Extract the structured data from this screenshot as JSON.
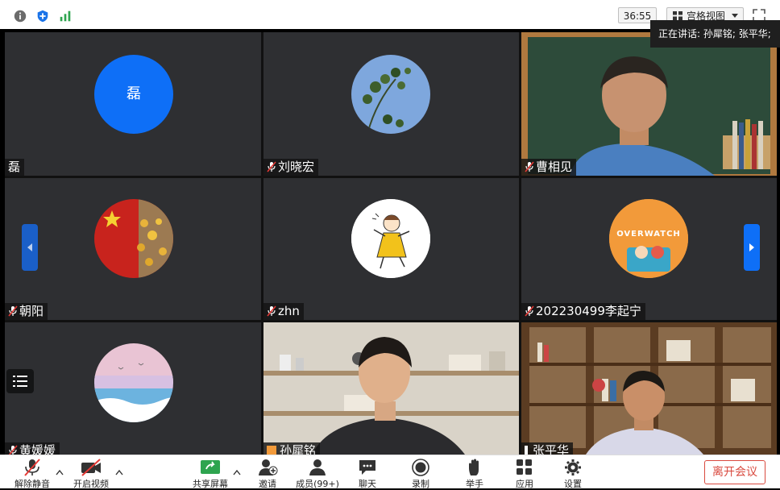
{
  "top_bar": {
    "info_icon": "info-icon",
    "shield_icon": "shield-icon",
    "signal_icon": "signal-icon",
    "timer": "36:55",
    "view_label": "宫格视图",
    "fullscreen_icon": "fullscreen-icon"
  },
  "speaking_banner": "正在讲话: 孙犀铭; 张平华;",
  "participants": [
    {
      "name": "磊",
      "avatar_text": "磊",
      "avatar_color": "#0e6ff7",
      "muted": false
    },
    {
      "name": "刘晓宏",
      "muted": true
    },
    {
      "name": "曹相见",
      "muted": true
    },
    {
      "name": "朝阳",
      "muted": true
    },
    {
      "name": "zhn",
      "muted": true
    },
    {
      "name": "202230499李起宁",
      "avatar_text": "OVERWATCH",
      "muted": true
    },
    {
      "name": "黄媛媛",
      "muted": true
    },
    {
      "name": "孙犀铭",
      "muted": false,
      "speaking": true
    },
    {
      "name": "张平华",
      "muted": false,
      "speaking": true
    }
  ],
  "toolbar": {
    "unmute": "解除静音",
    "start_video": "开启视频",
    "share_screen": "共享屏幕",
    "invite": "邀请",
    "members": "成员(99+)",
    "chat": "聊天",
    "record": "录制",
    "raise_hand": "举手",
    "apps": "应用",
    "settings": "设置",
    "leave": "离开会议"
  },
  "colors": {
    "accent": "#0e6ff7",
    "leave": "#d94a3f",
    "speaking_border": "#3fbf5a",
    "tile_bg": "#2e2f32"
  }
}
